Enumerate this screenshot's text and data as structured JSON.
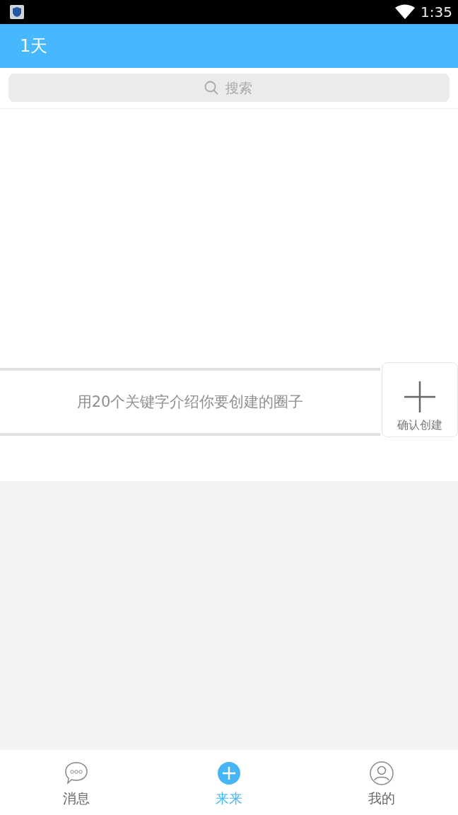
{
  "status_bar": {
    "time": "1:35"
  },
  "header": {
    "title": "1天"
  },
  "search": {
    "placeholder": "搜索"
  },
  "create": {
    "placeholder": "用20个关键字介绍你要创建的圈子",
    "button": "确认创建"
  },
  "tabs": [
    {
      "label": "消息",
      "kind": "chat",
      "selected": false
    },
    {
      "label": "来来",
      "kind": "plus",
      "selected": true
    },
    {
      "label": "我的",
      "kind": "person",
      "selected": false
    }
  ]
}
